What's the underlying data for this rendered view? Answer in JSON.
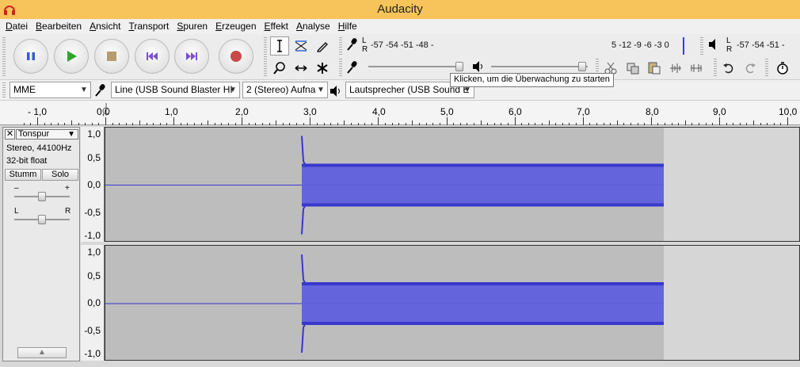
{
  "window": {
    "title": "Audacity"
  },
  "menu": [
    "Datei",
    "Bearbeiten",
    "Ansicht",
    "Transport",
    "Spuren",
    "Erzeugen",
    "Effekt",
    "Analyse",
    "Hilfe"
  ],
  "meters": {
    "record": {
      "lr_top": "L",
      "lr_bottom": "R",
      "scale": "-57 -54 -51 -48 -",
      "scale_right": "5 -12 -9 -6 -3 0"
    },
    "playback": {
      "lr_top": "L",
      "lr_bottom": "R",
      "scale": "-57 -54 -51 -"
    },
    "tooltip": "Klicken, um die Überwachung zu starten"
  },
  "devices": {
    "host": "MME",
    "input": "Line (USB Sound Blaster HI",
    "channels": "2 (Stereo) Aufna",
    "output": "Lautsprecher (USB Sound E"
  },
  "ruler": [
    "- 1,0",
    "0,0",
    "1,0",
    "2,0",
    "3,0",
    "4,0",
    "5,0",
    "6,0",
    "7,0",
    "8,0",
    "9,0",
    "10,0"
  ],
  "track": {
    "name": "Tonspur",
    "format": "Stereo, 44100Hz",
    "bitdepth": "32-bit float",
    "mute_label": "Stumm",
    "solo_label": "Solo",
    "gain_minus": "–",
    "gain_plus": "+",
    "pan_left": "L",
    "pan_right": "R"
  },
  "vruler": [
    "1,0",
    "0,5",
    "0,0",
    "-0,5",
    "-1,0"
  ],
  "colors": {
    "waveform": "#3838cc",
    "waveform_fill": "#6464dc",
    "titlebar": "#f6c45a"
  }
}
